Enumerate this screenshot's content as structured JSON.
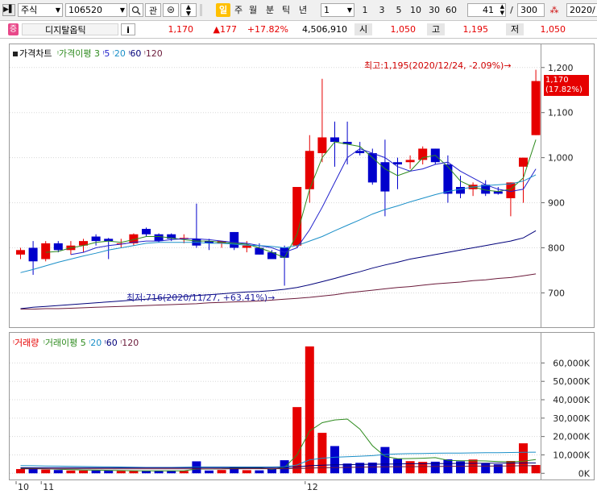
{
  "toolbar": {
    "market": "주식",
    "code": "106520",
    "btn_gwan": "관",
    "btn_il": "일",
    "btn_ju": "주",
    "btn_wol": "월",
    "btn_bun": "분",
    "btn_tik": "틱",
    "btn_nyeon": "년",
    "period_value": "1",
    "intervals": [
      "1",
      "3",
      "5",
      "10",
      "30",
      "60"
    ],
    "count_value": "41",
    "count_total": "300",
    "date_value": "2020/",
    "separator": "/"
  },
  "quote": {
    "badge": "증",
    "name": "디지탈옵틱",
    "info_btn": "i",
    "price": "1,170",
    "change": "▲177",
    "change_pct": "+17.82%",
    "volume": "4,506,910",
    "open_label": "시",
    "open": "1,050",
    "high_label": "고",
    "high": "1,195",
    "low_label": "저",
    "low": "1,050"
  },
  "price_legend": {
    "title": "가격차트",
    "ma_title": "가격이평",
    "ma_periods": [
      "3",
      "5",
      "20",
      "60",
      "120"
    ]
  },
  "volume_legend": {
    "title": "거래량",
    "ma_title": "거래이평",
    "ma_periods": [
      "5",
      "20",
      "60",
      "120"
    ]
  },
  "annotations": {
    "high": "최고:1,195(2020/12/24, -2.09%)→",
    "low": "최저:716(2020/11/27, +63.41%)→"
  },
  "current_price_tag": {
    "price": "1,170",
    "pct": "(17.82%)"
  },
  "colors": {
    "up": "#e60000",
    "down": "#0000cc",
    "ma3": "#2e8b1e",
    "ma5": "#2222cc",
    "ma20": "#1a8fc8",
    "ma60": "#00007a",
    "ma120": "#6b1a3a"
  },
  "x_labels": [
    {
      "label": "10",
      "index": 0
    },
    {
      "label": "11",
      "index": 2
    },
    {
      "label": "12",
      "index": 23
    }
  ],
  "chart_data": [
    {
      "type": "candlestick",
      "title": "가격차트",
      "ylim": [
        640,
        1230
      ],
      "yticks": [
        700,
        800,
        900,
        1000,
        1100,
        1200
      ],
      "ytick_labels": [
        "700",
        "800",
        "900",
        "1,000",
        "1,100",
        "1,200"
      ],
      "candles": [
        {
          "o": 785,
          "h": 800,
          "l": 775,
          "c": 795
        },
        {
          "o": 800,
          "h": 815,
          "l": 740,
          "c": 770
        },
        {
          "o": 775,
          "h": 815,
          "l": 770,
          "c": 810
        },
        {
          "o": 810,
          "h": 815,
          "l": 790,
          "c": 795
        },
        {
          "o": 795,
          "h": 815,
          "l": 785,
          "c": 805
        },
        {
          "o": 805,
          "h": 820,
          "l": 790,
          "c": 815
        },
        {
          "o": 825,
          "h": 830,
          "l": 805,
          "c": 815
        },
        {
          "o": 820,
          "h": 822,
          "l": 775,
          "c": 815
        },
        {
          "o": 810,
          "h": 820,
          "l": 800,
          "c": 810
        },
        {
          "o": 810,
          "h": 832,
          "l": 805,
          "c": 830
        },
        {
          "o": 842,
          "h": 845,
          "l": 825,
          "c": 830
        },
        {
          "o": 830,
          "h": 832,
          "l": 812,
          "c": 815
        },
        {
          "o": 830,
          "h": 832,
          "l": 815,
          "c": 820
        },
        {
          "o": 820,
          "h": 830,
          "l": 810,
          "c": 822
        },
        {
          "o": 820,
          "h": 898,
          "l": 800,
          "c": 805
        },
        {
          "o": 815,
          "h": 820,
          "l": 795,
          "c": 810
        },
        {
          "o": 810,
          "h": 815,
          "l": 800,
          "c": 815
        },
        {
          "o": 835,
          "h": 835,
          "l": 795,
          "c": 800
        },
        {
          "o": 800,
          "h": 815,
          "l": 790,
          "c": 805
        },
        {
          "o": 800,
          "h": 810,
          "l": 785,
          "c": 785
        },
        {
          "o": 790,
          "h": 795,
          "l": 775,
          "c": 775
        },
        {
          "o": 800,
          "h": 805,
          "l": 716,
          "c": 778
        },
        {
          "o": 805,
          "h": 825,
          "l": 800,
          "c": 935
        },
        {
          "o": 930,
          "h": 1050,
          "l": 900,
          "c": 1015
        },
        {
          "o": 1010,
          "h": 1175,
          "l": 990,
          "c": 1045
        },
        {
          "o": 1045,
          "h": 1080,
          "l": 980,
          "c": 1035
        },
        {
          "o": 1035,
          "h": 1080,
          "l": 985,
          "c": 1030
        },
        {
          "o": 1015,
          "h": 1035,
          "l": 1005,
          "c": 1010
        },
        {
          "o": 1010,
          "h": 1020,
          "l": 940,
          "c": 945
        },
        {
          "o": 990,
          "h": 1040,
          "l": 870,
          "c": 925
        },
        {
          "o": 990,
          "h": 1000,
          "l": 930,
          "c": 985
        },
        {
          "o": 990,
          "h": 1005,
          "l": 975,
          "c": 995
        },
        {
          "o": 995,
          "h": 1025,
          "l": 985,
          "c": 1020
        },
        {
          "o": 1020,
          "h": 1020,
          "l": 985,
          "c": 990
        },
        {
          "o": 985,
          "h": 1005,
          "l": 900,
          "c": 920
        },
        {
          "o": 935,
          "h": 960,
          "l": 910,
          "c": 920
        },
        {
          "o": 930,
          "h": 945,
          "l": 915,
          "c": 940
        },
        {
          "o": 940,
          "h": 950,
          "l": 915,
          "c": 920
        },
        {
          "o": 925,
          "h": 935,
          "l": 918,
          "c": 920
        },
        {
          "o": 910,
          "h": 945,
          "l": 870,
          "c": 945
        },
        {
          "o": 980,
          "h": 1000,
          "l": 900,
          "c": 1000
        },
        {
          "o": 1050,
          "h": 1195,
          "l": 1050,
          "c": 1170
        }
      ],
      "series": [
        {
          "name": "3",
          "values": [
            null,
            null,
            790,
            792,
            800,
            805,
            812,
            815,
            812,
            818,
            825,
            825,
            822,
            818,
            815,
            815,
            812,
            810,
            808,
            800,
            790,
            778,
            830,
            930,
            1000,
            1035,
            1030,
            1025,
            1000,
            975,
            960,
            970,
            1000,
            1005,
            980,
            948,
            935,
            928,
            925,
            930,
            955,
            1040
          ]
        },
        {
          "name": "5",
          "values": [
            null,
            null,
            null,
            null,
            785,
            790,
            800,
            805,
            808,
            812,
            815,
            815,
            818,
            820,
            820,
            818,
            815,
            812,
            810,
            805,
            800,
            790,
            800,
            840,
            890,
            945,
            1000,
            1020,
            1010,
            1000,
            980,
            970,
            975,
            985,
            990,
            970,
            955,
            940,
            930,
            925,
            930,
            975
          ]
        },
        {
          "name": "20",
          "values": [
            745,
            752,
            760,
            768,
            775,
            782,
            788,
            795,
            800,
            805,
            810,
            812,
            812,
            812,
            812,
            810,
            810,
            808,
            806,
            805,
            803,
            800,
            805,
            815,
            825,
            838,
            850,
            862,
            875,
            885,
            893,
            902,
            910,
            918,
            925,
            930,
            935,
            938,
            940,
            942,
            948,
            962
          ]
        },
        {
          "name": "60",
          "values": [
            665,
            668,
            670,
            672,
            674,
            676,
            678,
            680,
            682,
            684,
            686,
            688,
            690,
            692,
            694,
            696,
            698,
            700,
            702,
            703,
            705,
            708,
            712,
            718,
            725,
            732,
            740,
            747,
            755,
            762,
            768,
            775,
            780,
            785,
            790,
            795,
            800,
            805,
            810,
            815,
            822,
            838
          ]
        },
        {
          "name": "120",
          "values": [
            664,
            664,
            665,
            665,
            666,
            667,
            668,
            669,
            670,
            671,
            672,
            673,
            674,
            675,
            676,
            678,
            679,
            680,
            681,
            682,
            684,
            686,
            688,
            690,
            693,
            696,
            700,
            703,
            706,
            709,
            712,
            714,
            717,
            720,
            722,
            724,
            727,
            729,
            732,
            734,
            738,
            742
          ]
        }
      ]
    },
    {
      "type": "bar",
      "title": "거래량",
      "ylim": [
        -2500,
        72000
      ],
      "yticks": [
        0,
        10000,
        20000,
        30000,
        40000,
        50000,
        60000
      ],
      "ytick_labels": [
        "0K",
        "10,000K",
        "20,000K",
        "30,000K",
        "40,000K",
        "50,000K",
        "60,000K"
      ],
      "values": [
        2300,
        2300,
        2000,
        1800,
        1500,
        1500,
        1500,
        1400,
        1300,
        1200,
        1200,
        1300,
        1300,
        1300,
        6500,
        1500,
        1800,
        3200,
        1700,
        1600,
        2500,
        7100,
        36000,
        69000,
        22000,
        14800,
        5300,
        5700,
        5800,
        14300,
        7800,
        6600,
        6200,
        6300,
        7600,
        6500,
        7500,
        5600,
        4900,
        6700,
        16300,
        4500
      ],
      "series": [
        {
          "name": "5",
          "values": [
            2800,
            2600,
            2400,
            2200,
            2000,
            1800,
            1700,
            1600,
            1500,
            1400,
            1350,
            1300,
            1300,
            1300,
            2300,
            2300,
            2400,
            2700,
            2900,
            2900,
            2200,
            3100,
            10000,
            23000,
            27500,
            29000,
            29500,
            24000,
            15000,
            9200,
            7900,
            8000,
            8200,
            8500,
            7000,
            6800,
            6800,
            6700,
            6400,
            6200,
            6600,
            7500
          ]
        },
        {
          "name": "20",
          "values": [
            4200,
            4100,
            4000,
            3900,
            3800,
            3700,
            3600,
            3500,
            3400,
            3300,
            3200,
            3200,
            3200,
            3300,
            3400,
            3400,
            3400,
            3400,
            3400,
            3400,
            3400,
            3600,
            4500,
            7300,
            8200,
            8700,
            9000,
            9300,
            9600,
            10200,
            10500,
            10700,
            10800,
            10900,
            11000,
            11000,
            11100,
            11200,
            11200,
            11300,
            11400,
            11500
          ]
        },
        {
          "name": "60",
          "values": [
            3000,
            3000,
            3000,
            3000,
            3000,
            3000,
            3000,
            3000,
            3000,
            3000,
            3000,
            3000,
            3000,
            3000,
            3100,
            3100,
            3100,
            3100,
            3100,
            3100,
            3100,
            3200,
            3500,
            4100,
            4400,
            4600,
            4700,
            4800,
            4900,
            5000,
            5100,
            5200,
            5200,
            5300,
            5300,
            5400,
            5400,
            5500,
            5500,
            5500,
            5600,
            5600
          ]
        },
        {
          "name": "120",
          "values": [
            2400,
            2400,
            2400,
            2400,
            2400,
            2400,
            2400,
            2400,
            2400,
            2400,
            2400,
            2400,
            2400,
            2400,
            2400,
            2400,
            2400,
            2400,
            2500,
            2500,
            2500,
            2500,
            2600,
            2800,
            3000,
            3100,
            3200,
            3300,
            3400,
            3500,
            3600,
            3600,
            3700,
            3700,
            3800,
            3800,
            3900,
            3900,
            4000,
            4000,
            4100,
            4100
          ]
        }
      ]
    }
  ]
}
